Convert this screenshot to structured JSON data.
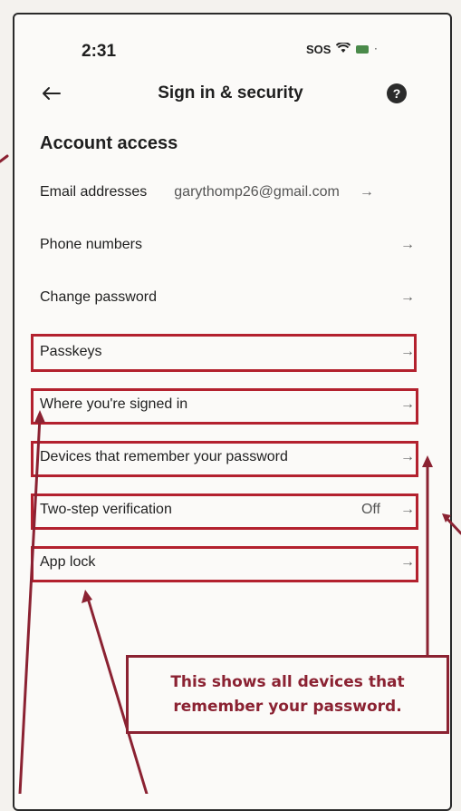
{
  "status_bar": {
    "time": "2:31",
    "sos": "SOS"
  },
  "header": {
    "title": "Sign in & security",
    "help_glyph": "?"
  },
  "section": {
    "title": "Account access"
  },
  "rows": [
    {
      "label": "Email addresses",
      "value": "garythomp26@gmail.com",
      "arrow": "→"
    },
    {
      "label": "Phone numbers",
      "arrow": "→"
    },
    {
      "label": "Change password",
      "arrow": "→"
    },
    {
      "label": "Passkeys",
      "arrow": "→"
    },
    {
      "label": "Where you're signed in",
      "arrow": "→"
    },
    {
      "label": "Devices that remember your password",
      "arrow": "→"
    },
    {
      "label": "Two-step verification",
      "value": "Off",
      "arrow": "→"
    },
    {
      "label": "App lock",
      "arrow": "→"
    }
  ],
  "callout": {
    "text": "This shows all devices that remember your password."
  },
  "colors": {
    "annotation_red": "#b3212e",
    "callout_text": "#8b2232",
    "background": "#fbfaf8"
  },
  "icons": {
    "back": "back-arrow-icon",
    "help": "help-icon",
    "wifi": "wifi-icon",
    "battery": "battery-icon",
    "row_arrow": "arrow-right-icon"
  }
}
